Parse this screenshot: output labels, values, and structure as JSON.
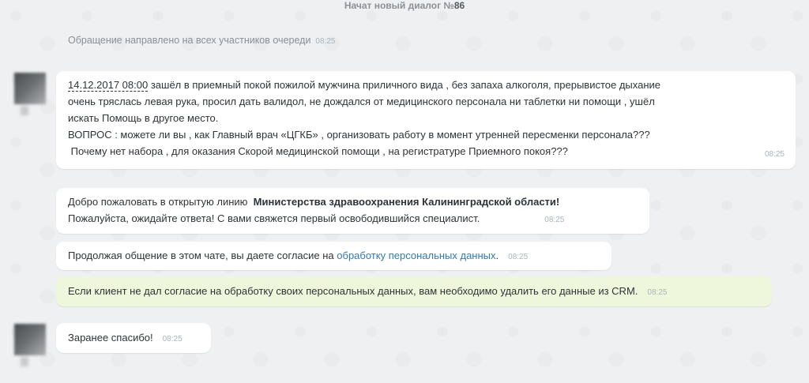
{
  "header": {
    "prefix": "Начат новый диалог №",
    "number": "86"
  },
  "system": {
    "text": "Обращение направлено на всех участников очереди",
    "time": "08:25"
  },
  "messages": [
    {
      "date_link": "14.12.2017 08:00",
      "line1_rest": " зашёл в приемный покой пожилой мужчина приличного вида , без запаха алкоголя, прерывистое дыхание",
      "line2": "очень тряслась левая рука, просил дать валидол, не дождался от медицинского персонала ни таблетки ни помощи , ушёл",
      "line3": "искать Помощь в другое место.",
      "line4": "ВОПРОС : можете ли вы , как Главный врач «ЦГКБ» , организовать работу в момент утренней пересменки персонала???",
      "line5": " Почему нет набора , для оказания Скорой медицинской помощи , на регистратуре Приемного покоя???",
      "time": "08:25"
    },
    {
      "prefix": "Добро пожаловать в открытую линию  ",
      "bold": "Министерства здравоохранения Калининградской области!",
      "line2": "Пожалуйста, ожидайте ответа! С вами свяжется первый освободившийся специалист.",
      "time": "08:25"
    },
    {
      "prefix": "Продолжая общение в этом чате, вы даете согласие на ",
      "link": "обработку персональных данных",
      "suffix": ".",
      "time": "08:25"
    },
    {
      "text": "Если клиент не дал согласие на обработку своих персональных данных, вам необходимо удалить его данные из CRM.",
      "time": "08:25"
    },
    {
      "text": "Заранее спасибо!",
      "time": "08:25"
    }
  ]
}
